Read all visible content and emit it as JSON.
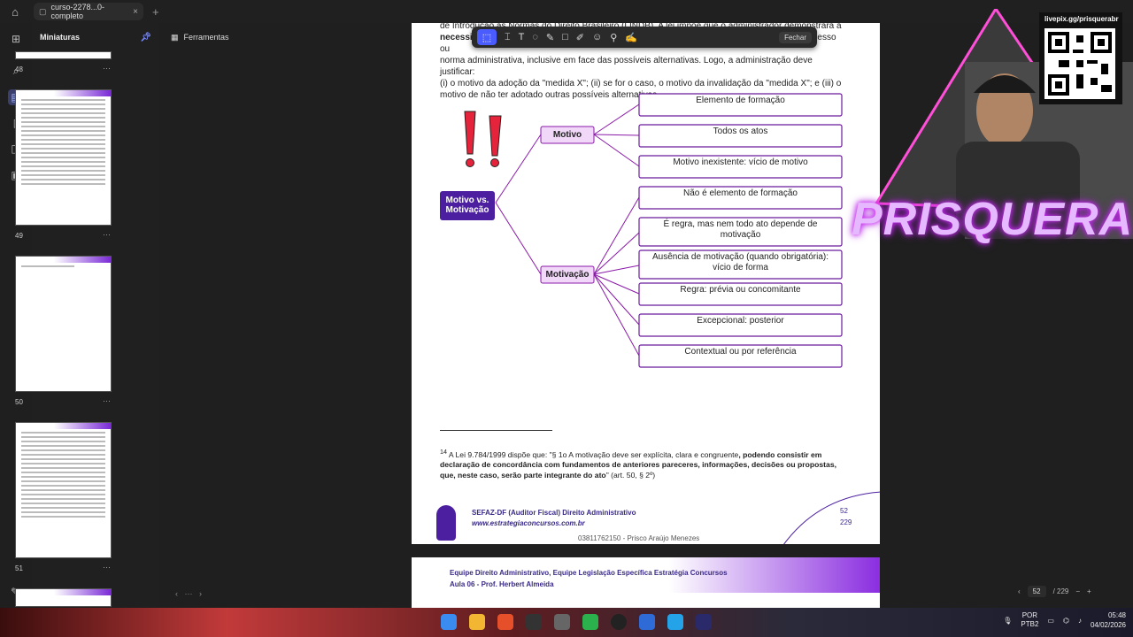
{
  "window": {
    "tab_title": "curso-2278...0-completo",
    "tab_close": "×",
    "new_tab": "+"
  },
  "sidebar": {
    "title": "Miniaturas",
    "pages": [
      {
        "num": "48"
      },
      {
        "num": "49"
      },
      {
        "num": "50"
      },
      {
        "num": "51"
      }
    ],
    "more": "···"
  },
  "tools": {
    "label": "Ferramentas"
  },
  "annot_toolbar": {
    "close_label": "Fechar"
  },
  "document": {
    "intro_line1_a": "de Introdução às Normas do Direito Brasileiro (LINDB). A lei impõe que o administrador demonstrará a",
    "intro_line2_bold": "necessidade",
    "intro_line2_rest": " e a adequação da medida imposta ou da invalidação de ato, contrato, ajuste, processo ou",
    "intro_line3": "norma administrativa, inclusive em face das possíveis alternativas. Logo, a administração deve justificar:",
    "intro_line4": "(i) o motivo da adoção da \"medida X\"; (ii) se for o caso, o motivo da invalidação da \"medida X\"; e (iii) o",
    "intro_line5": "motivo de não ter adotado outras possíveis alternativas.",
    "diagram": {
      "root": "Motivo vs. Motivação",
      "motivo": {
        "label": "Motivo",
        "items": [
          "Elemento de formação",
          "Todos os atos",
          "Motivo inexistente: vício de motivo"
        ]
      },
      "motivacao": {
        "label": "Motivação",
        "items": [
          "Não é elemento de formação",
          "É regra, mas nem todo ato depende de motivação",
          "Ausência de motivação (quando obrigatória): vício de forma",
          "Regra: prévia ou concomitante",
          "Excepcional: posterior",
          "Contextual ou por referência"
        ]
      }
    },
    "footnote_sup": "14",
    "footnote_a": " A Lei 9.784/1999 dispõe que: \"§ 1o A motivação deve ser explícita, clara e congruente",
    "footnote_b": ", podendo consistir em declaração de concordância com fundamentos de anteriores pareceres, informações, decisões ou propostas, que, neste caso, serão parte integrante do ato",
    "footnote_c": "\" (art. 50, § 2º)",
    "footer_course": "SEFAZ-DF (Auditor Fiscal) Direito Administrativo",
    "footer_site": "www.estrategiaconcursos.com.br",
    "page_num": "52",
    "page_total": "229",
    "footer_id": "03811762150 - Prisco Araújo Menezes",
    "next_header1": "Equipe Direito Administrativo, Equipe Legislação Específica Estratégia Concursos",
    "next_header2": "Aula 06 - Prof. Herbert Almeida"
  },
  "stream": {
    "brand": "PRISQUERA",
    "livepix": "livepix.gg/prisquerabr"
  },
  "pagenav": {
    "current": "52",
    "total": "/ 229"
  },
  "tray": {
    "lang": "POR",
    "layout": "PTB2",
    "time": "05:48",
    "date": "04/02/2026"
  },
  "colors": {
    "accent": "#4b5cff",
    "diagram_purple": "#8a1aa8",
    "root_fill": "#4b1fa0"
  }
}
